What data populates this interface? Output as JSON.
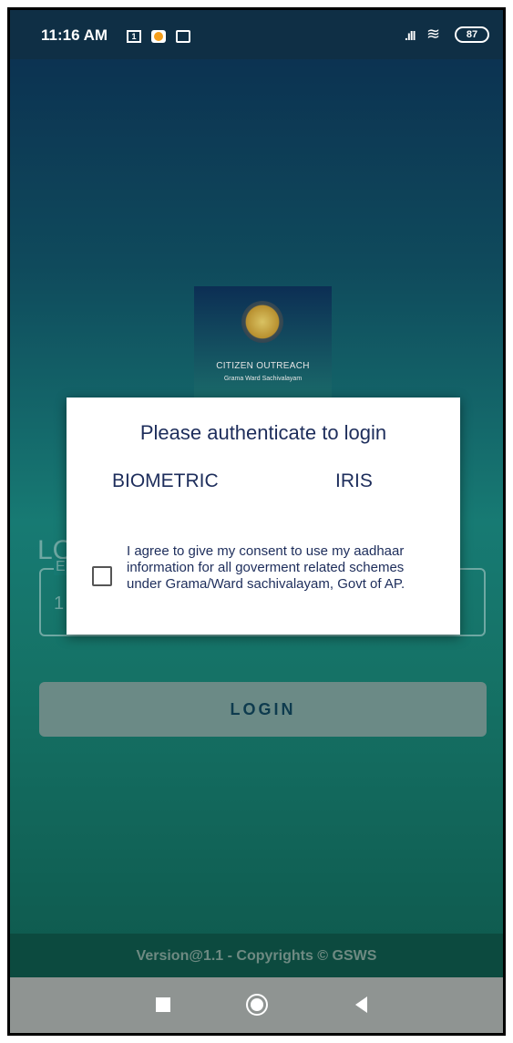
{
  "statusbar": {
    "time": "11:16 AM",
    "calendar_day": "1",
    "battery": "87",
    "icons": [
      "calendar-icon",
      "app-notification-icon",
      "message-icon",
      "signal-icon",
      "wifi-icon",
      "battery-icon"
    ]
  },
  "logo": {
    "title": "CITIZEN OUTREACH",
    "subtitle": "Grama Ward Sachivalayam"
  },
  "background_form": {
    "title_partial": "LO",
    "field_label_partial": "E",
    "field_value_partial": "1",
    "login_button": "LOGIN"
  },
  "dialog": {
    "title": "Please authenticate to login",
    "biometric_option": "BIOMETRIC",
    "iris_option": "IRIS",
    "consent_checked": false,
    "consent_text": "I agree to give my consent to use my aadhaar information for all goverment related schemes under Grama/Ward sachivalayam, Govt of AP."
  },
  "footer": {
    "text": "Version@1.1 - Copyrights © GSWS"
  },
  "navbar": {
    "icons": [
      "recents-icon",
      "home-icon",
      "back-icon"
    ]
  },
  "colors": {
    "dialog_text": "#1d2d5b",
    "login_button_bg": "#6b8a86",
    "footer_bg": "#0c4a3f"
  }
}
